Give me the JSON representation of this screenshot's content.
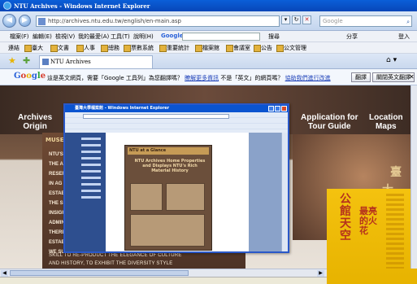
{
  "window": {
    "title": "NTU Archives - Windows Internet Explorer"
  },
  "address": {
    "url": "http://archives.ntu.edu.tw/english/en-main.asp",
    "search_placeholder": "Google"
  },
  "menubar": {
    "items": [
      "檔案(F)",
      "編輯(E)",
      "檢視(V)",
      "我的最愛(A)",
      "工具(T)",
      "說明(H)"
    ],
    "google_label": "Google",
    "search_btn": "搜尋",
    "share_btn": "分享",
    "login_btn": "登入"
  },
  "links": {
    "label": "連結",
    "items": [
      "臺大",
      "文書",
      "人事",
      "總務",
      "票數系統",
      "重要統計",
      "檔案館",
      "會議室",
      "公告",
      "公文管理"
    ]
  },
  "tabbar": {
    "tab_title": "NTU Archives"
  },
  "translate": {
    "logo": [
      "G",
      "o",
      "o",
      "g",
      "l",
      "e"
    ],
    "message": "這是英文網頁，需要「Google 工具列」為您翻譯嗎？",
    "more_link": "瞭解更多資訊",
    "not_english": "不是「英文」的網頁嗎？",
    "options_link": "協助我們進行改進",
    "translate_btn": "翻譯",
    "always_btn": "關閉英文翻譯"
  },
  "site": {
    "nav": {
      "origin": [
        "Archives",
        "Origin"
      ],
      "tour": [
        "Application for",
        "Tour Guide"
      ],
      "maps": [
        "Location",
        "Maps"
      ]
    },
    "museum": {
      "heading": "MUSE",
      "text_lines": [
        "NTU'S",
        "THE A",
        "RESER",
        "IN AG",
        "ESTAB",
        "THE S",
        "INSIGH",
        "ADMIN",
        "THERE",
        "ESTAB",
        "WE SU"
      ],
      "footer_lines": [
        "SKILL TO RE-PRODUCT THE ELEGANCE OF CULTURE",
        "AND HISTORY, TO EXHIBIT THE DIVERSITY STYLE"
      ]
    },
    "deco_chars": [
      "臺",
      "大",
      "公"
    ],
    "poster": {
      "title": "公館天空",
      "subtitle": "最亮的火花"
    }
  },
  "inner_window": {
    "title": "臺灣大學檔案館 - Windows Internet Explorer",
    "card_head": "NTU at a Glance",
    "card_title": "NTU Archives Home Properties and Displays NTU's Rich Material History"
  }
}
